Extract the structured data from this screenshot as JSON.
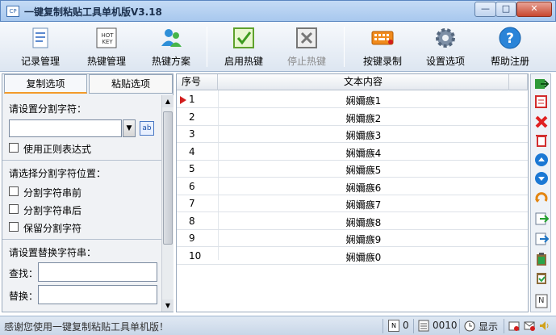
{
  "window": {
    "title": "一键复制粘贴工具单机版V3.18",
    "icon_text": "CP",
    "min_label": "—",
    "max_label": "□",
    "close_label": "✕"
  },
  "toolbar": {
    "items": [
      {
        "label": "记录管理",
        "icon": "records-icon",
        "enabled": true
      },
      {
        "label": "热键管理",
        "icon": "hotkey-icon",
        "enabled": true
      },
      {
        "label": "热键方案",
        "icon": "users-icon",
        "enabled": true
      },
      {
        "label": "启用热键",
        "icon": "checkmark-icon",
        "enabled": true
      },
      {
        "label": "停止热键",
        "icon": "stop-x-icon",
        "enabled": false
      },
      {
        "label": "按键录制",
        "icon": "keyboard-icon",
        "enabled": true
      },
      {
        "label": "设置选项",
        "icon": "gear-icon",
        "enabled": true
      },
      {
        "label": "帮助注册",
        "icon": "help-icon",
        "enabled": true
      }
    ],
    "hotkey_icon_text": "HOT KEY"
  },
  "left_panel": {
    "tabs": [
      {
        "label": "复制选项",
        "active": true
      },
      {
        "label": "粘贴选项",
        "active": false
      }
    ],
    "separator_prompt": "请设置分割字符：",
    "separator_value": "",
    "ab_icon_text": "ab",
    "regex_label": "使用正则表达式",
    "position_prompt": "请选择分割字符位置：",
    "position_options": [
      "分割字符串前",
      "分割字符串后",
      "保留分割字符"
    ],
    "replace_prompt": "请设置替换字符串：",
    "find_label": "查找：",
    "replace_label": "替换：",
    "find_value": "",
    "replace_value": ""
  },
  "table": {
    "headers": {
      "num": "序号",
      "content": "文本内容"
    },
    "rows": [
      {
        "num": "1",
        "text": "娴嬭瘯1"
      },
      {
        "num": "2",
        "text": "娴嬭瘯2"
      },
      {
        "num": "3",
        "text": "娴嬭瘯3"
      },
      {
        "num": "4",
        "text": "娴嬭瘯4"
      },
      {
        "num": "5",
        "text": "娴嬭瘯5"
      },
      {
        "num": "6",
        "text": "娴嬭瘯6"
      },
      {
        "num": "7",
        "text": "娴嬭瘯7"
      },
      {
        "num": "8",
        "text": "娴嬭瘯8"
      },
      {
        "num": "9",
        "text": "娴嬭瘯9"
      },
      {
        "num": "10",
        "text": "娴嬭瘯0"
      }
    ]
  },
  "right_toolbar": {
    "icons": [
      "export-icon",
      "edit-icon",
      "delete-x-icon",
      "trash-icon",
      "move-up-icon",
      "move-down-icon",
      "undo-icon",
      "import-icon",
      "import-alt-icon",
      "clipboard-icon",
      "clipboard-paste-icon",
      "notepad-icon"
    ],
    "notepad_text": "N"
  },
  "status": {
    "message": "感谢您使用一键复制粘贴工具单机版！",
    "count": "0",
    "code": "0010",
    "display": "显示",
    "n_icon_text": "N"
  },
  "colors": {
    "accent_orange": "#f39b2a",
    "marker_red": "#d21e1e",
    "titlebar": "#a8c8ee"
  }
}
